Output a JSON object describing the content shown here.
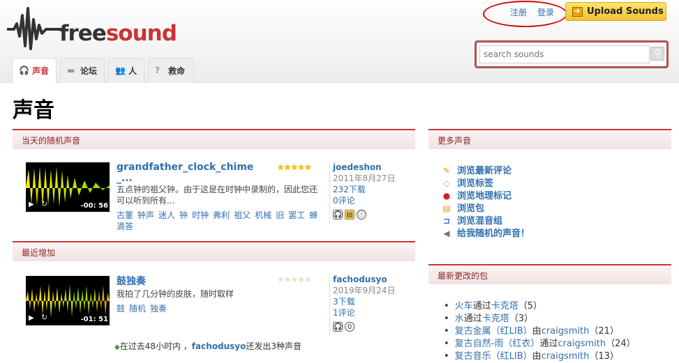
{
  "header": {
    "logo_text_a": "free",
    "logo_text_b": "sound",
    "register": "注册",
    "login": "登录",
    "upload": "Upload Sounds",
    "search_placeholder": "search sounds"
  },
  "tabs": [
    {
      "label": "声音",
      "icon": "headphones-icon"
    },
    {
      "label": "论坛",
      "icon": "speech-bubble-icon"
    },
    {
      "label": "人",
      "icon": "people-icon"
    },
    {
      "label": "救命",
      "icon": "help-icon"
    }
  ],
  "page_title": "声音",
  "random_box": {
    "title": "当天的随机声音",
    "sound": {
      "name_line1": "grandfather_clock_chime",
      "name_line2": "_...",
      "desc_line1": "五点钟的祖父钟。由于这是在时钟中录制的，因此您还",
      "desc_line2": "可以听到所有...",
      "tags_line1": [
        "古董",
        "钟声",
        "迷人",
        "钟",
        "时钟",
        "弗利",
        "祖父",
        "机械",
        "旧",
        "罢工",
        "蝉"
      ],
      "tags_line2": [
        "滴答"
      ],
      "user": "joedeshon",
      "date": "2011年8月27日",
      "downloads": "232下载",
      "comments": "0评论",
      "time": "-00: 56",
      "rating": 5
    }
  },
  "latest_box": {
    "title": "最近增加",
    "sound": {
      "name": "鼓独奏",
      "desc": "我拍了几分钟的皮肤，随时取样",
      "tags": [
        "鼓",
        "随机",
        "独奏"
      ],
      "user": "fachodusyo",
      "date": "2019年9月24日",
      "downloads": "3下载",
      "comments": "1评论",
      "time": "-01: 51",
      "rating": 0
    },
    "footer_pre": "在过去48小时内 ，",
    "footer_user": "fachodusyo",
    "footer_post": "还发出3种声音"
  },
  "more_box": {
    "title": "更多声音",
    "items": [
      {
        "label": "浏览最新评论",
        "icon": "pencil-icon"
      },
      {
        "label": "浏览标签",
        "icon": "tag-icon"
      },
      {
        "label": "浏览地理标记",
        "icon": "map-pin-icon"
      },
      {
        "label": "浏览包",
        "icon": "package-icon"
      },
      {
        "label": "浏览混音组",
        "icon": "remix-icon"
      },
      {
        "label": "给我随机的声音！",
        "icon": "speaker-icon"
      }
    ]
  },
  "packs_box": {
    "title": "最新更改的包",
    "items": [
      {
        "link": "火车",
        "mid": "通过",
        "link2": "卡克塔",
        "suffix": "（5）"
      },
      {
        "link": "水",
        "mid": "通过",
        "link2": "卡克塔",
        "suffix": "（3）"
      },
      {
        "link": "复古金属（红LIB）",
        "mid": "由",
        "link2": "craigsmith",
        "suffix": "（21）"
      },
      {
        "link": "复古自然-雨（红衣）",
        "mid": "通过",
        "link2": "craigsmith",
        "suffix": "（24）"
      },
      {
        "link": "复古音乐（红LIB）",
        "mid": "由",
        "link2": "craigsmith",
        "suffix": "（13）"
      }
    ]
  },
  "colors": {
    "brand_red": "#cc3333",
    "link_blue": "#2f6fb0",
    "star_gold": "#f5c400"
  }
}
